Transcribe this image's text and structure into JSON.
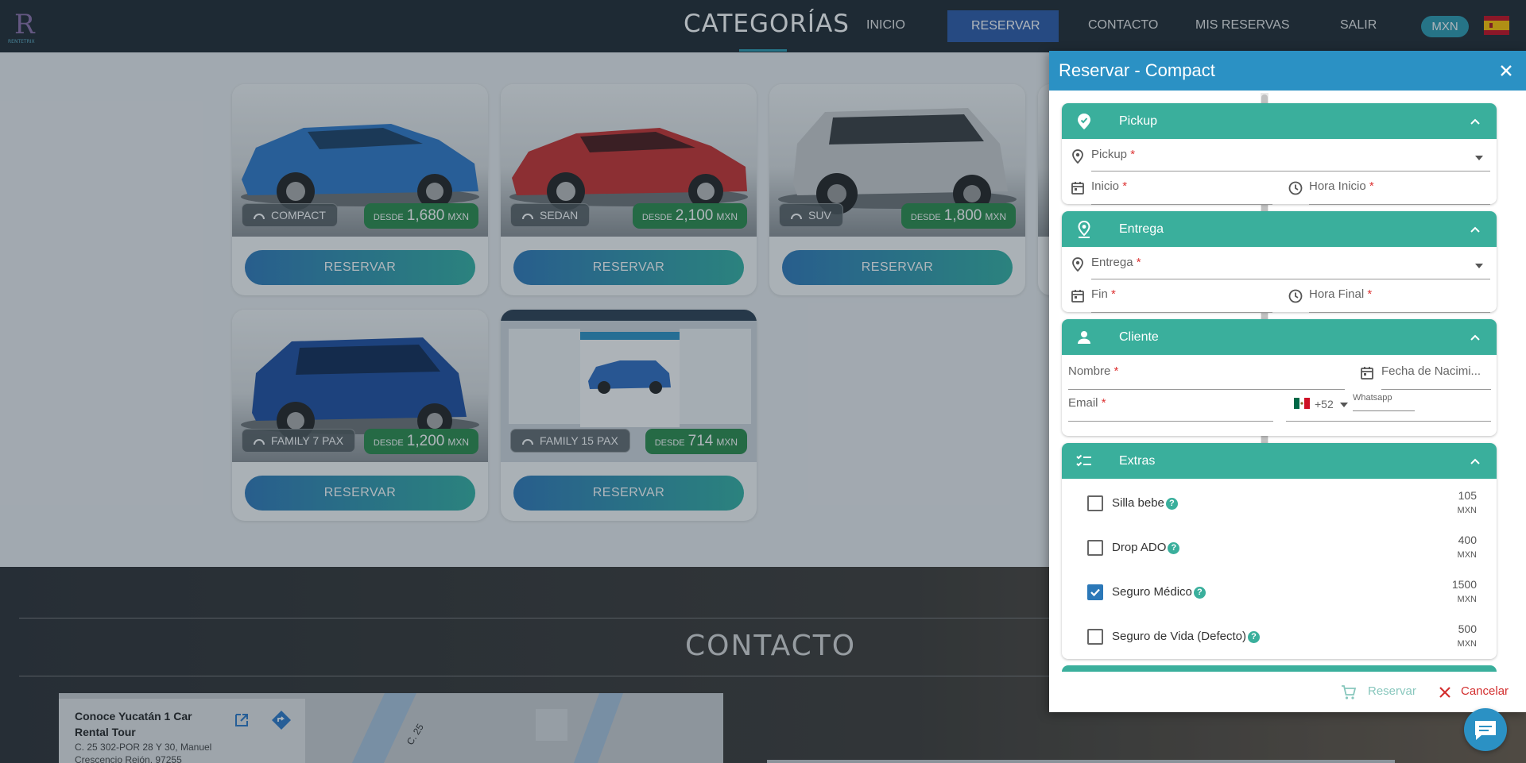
{
  "navbar": {
    "title": "CATEGORÍAS",
    "items": [
      "INICIO",
      "RESERVAR",
      "CONTACTO",
      "MIS RESERVAS",
      "SALIR"
    ],
    "currency": "MXN",
    "logo_text": "RENTETRIX"
  },
  "cards": [
    {
      "category": "COMPACT",
      "desde": "DESDE",
      "price": "1,680",
      "currency": "MXN",
      "button": "RESERVAR",
      "color": "#2f78c8"
    },
    {
      "category": "SEDAN",
      "desde": "DESDE",
      "price": "2,100",
      "currency": "MXN",
      "button": "RESERVAR",
      "color": "#c8302e"
    },
    {
      "category": "SUV",
      "desde": "DESDE",
      "price": "1,800",
      "currency": "MXN",
      "button": "RESERVAR",
      "color": "#c9cbcc"
    },
    {
      "category": "FAMILY 7 PAX",
      "desde": "DESDE",
      "price": "1,200",
      "currency": "MXN",
      "button": "RESERVAR",
      "color": "#1e4ea0"
    },
    {
      "category": "FAMILY 15 PAX",
      "desde": "DESDE",
      "price": "714",
      "currency": "MXN",
      "button": "RESERVAR",
      "color": "#2f6cc0"
    }
  ],
  "contact": {
    "title": "CONTACTO",
    "map_place": "Conoce Yucatán 1 Car Rental Tour",
    "map_address": "C. 25 302-POR 28 Y 30, Manuel Crescencio Rejón, 97255",
    "street_label": "C. 25"
  },
  "dialog": {
    "title": "Reservar - Compact",
    "sections": {
      "pickup": {
        "title": "Pickup",
        "fields": {
          "location": "Pickup",
          "start": "Inicio",
          "start_time": "Hora Inicio"
        }
      },
      "entrega": {
        "title": "Entrega",
        "fields": {
          "location": "Entrega",
          "end": "Fin",
          "end_time": "Hora Final"
        }
      },
      "cliente": {
        "title": "Cliente",
        "fields": {
          "name": "Nombre",
          "birth": "Fecha de Nacimi...",
          "email": "Email",
          "phone_code": "+52",
          "whatsapp": "Whatsapp"
        }
      },
      "extras": {
        "title": "Extras",
        "items": [
          {
            "label": "Silla bebe",
            "price": "105",
            "currency": "MXN",
            "checked": false
          },
          {
            "label": "Drop ADO",
            "price": "400",
            "currency": "MXN",
            "checked": false
          },
          {
            "label": "Seguro Médico",
            "price": "1500",
            "currency": "MXN",
            "checked": true
          },
          {
            "label": "Seguro de Vida (Defecto)",
            "price": "500",
            "currency": "MXN",
            "checked": false
          }
        ]
      }
    },
    "required_mark": "*",
    "help_mark": "?",
    "footer": {
      "reservar": "Reservar",
      "cancelar": "Cancelar"
    }
  },
  "colors": {
    "accent": "#3aaf9c",
    "header": "#2b91c4",
    "danger": "#d32f2f",
    "check": "#2b78b8"
  }
}
